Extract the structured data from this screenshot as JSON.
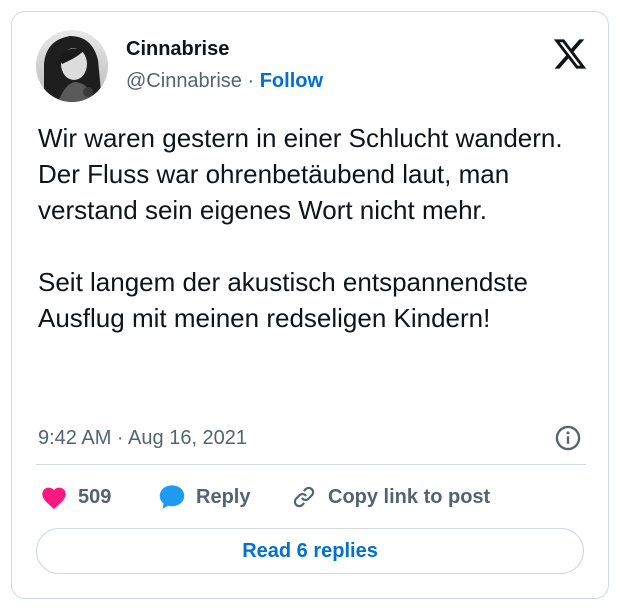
{
  "author": {
    "name": "Cinnabrise",
    "handle": "@Cinnabrise",
    "separator": "·",
    "follow_label": "Follow",
    "avatar_icon": "user-photo-avatar"
  },
  "platform_icon": "x-logo-icon",
  "tweet": {
    "paragraphs": [
      "Wir waren gestern in einer Schlucht wandern. Der Fluss war ohrenbetäubend laut, man verstand sein eigenes Wort nicht mehr.",
      "Seit langem der akustisch entspannendste Ausflug mit meinen redseligen Kindern!"
    ],
    "timestamp": "9:42 AM · Aug 16, 2021",
    "info_icon": "info-icon"
  },
  "actions": {
    "like_count": "509",
    "reply_label": "Reply",
    "copy_label": "Copy link to post"
  },
  "read_replies_label": "Read 6 replies",
  "colors": {
    "accent": "#006fd6",
    "heart": "#f91880",
    "reply_bubble": "#1d9bf0",
    "muted_text": "#536471",
    "border": "#cfd9de"
  }
}
